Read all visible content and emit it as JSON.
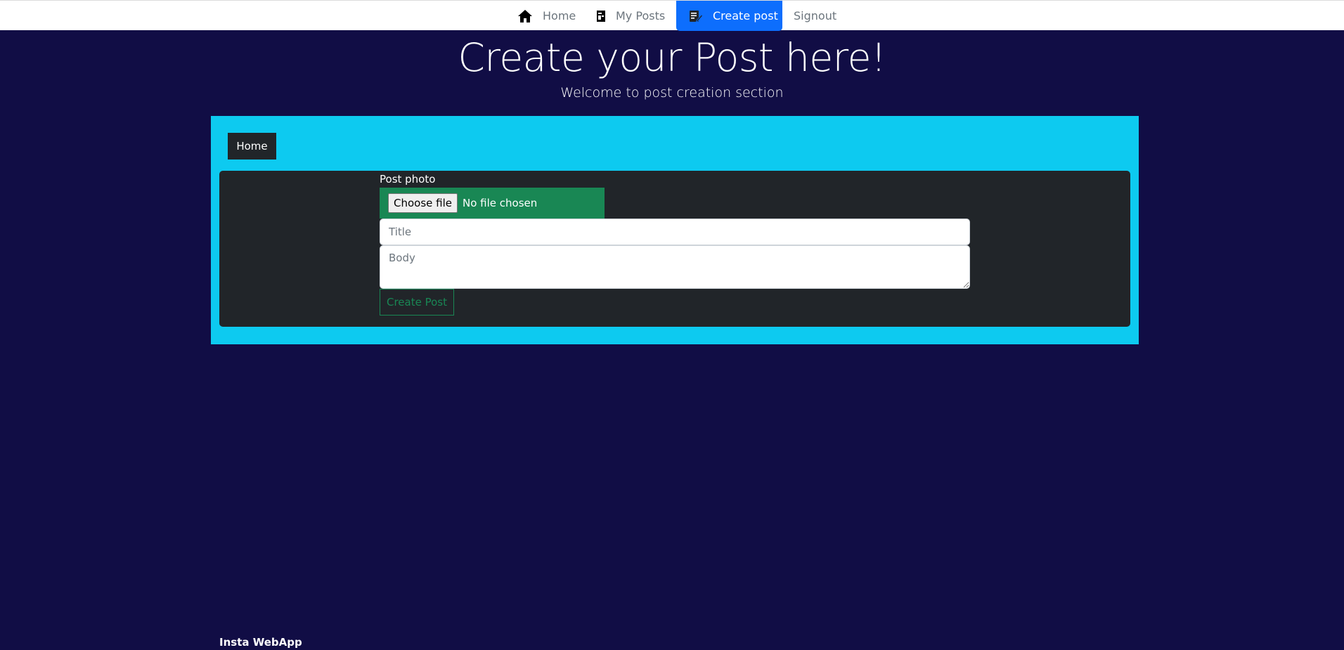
{
  "nav": {
    "home": "Home",
    "my_posts": "My Posts",
    "create_post": "Create post",
    "signout": "Signout"
  },
  "header": {
    "title": "Create your Post here!",
    "subtitle": "Welcome to post creation section"
  },
  "panel": {
    "home_button": "Home"
  },
  "form": {
    "photo_label": "Post photo",
    "choose_file": "Choose file",
    "no_file": "No file chosen",
    "title_placeholder": "Title",
    "body_placeholder": "Body",
    "submit": "Create Post"
  },
  "footer": {
    "brand": "Insta WebApp"
  },
  "colors": {
    "background": "#110d45",
    "panel": "#0dcaf0",
    "card": "#212529",
    "active_nav": "#0d6efd",
    "success": "#198754"
  },
  "icons": {
    "home": "home-icon",
    "my_posts": "document-icon",
    "create_post": "edit-document-icon"
  }
}
